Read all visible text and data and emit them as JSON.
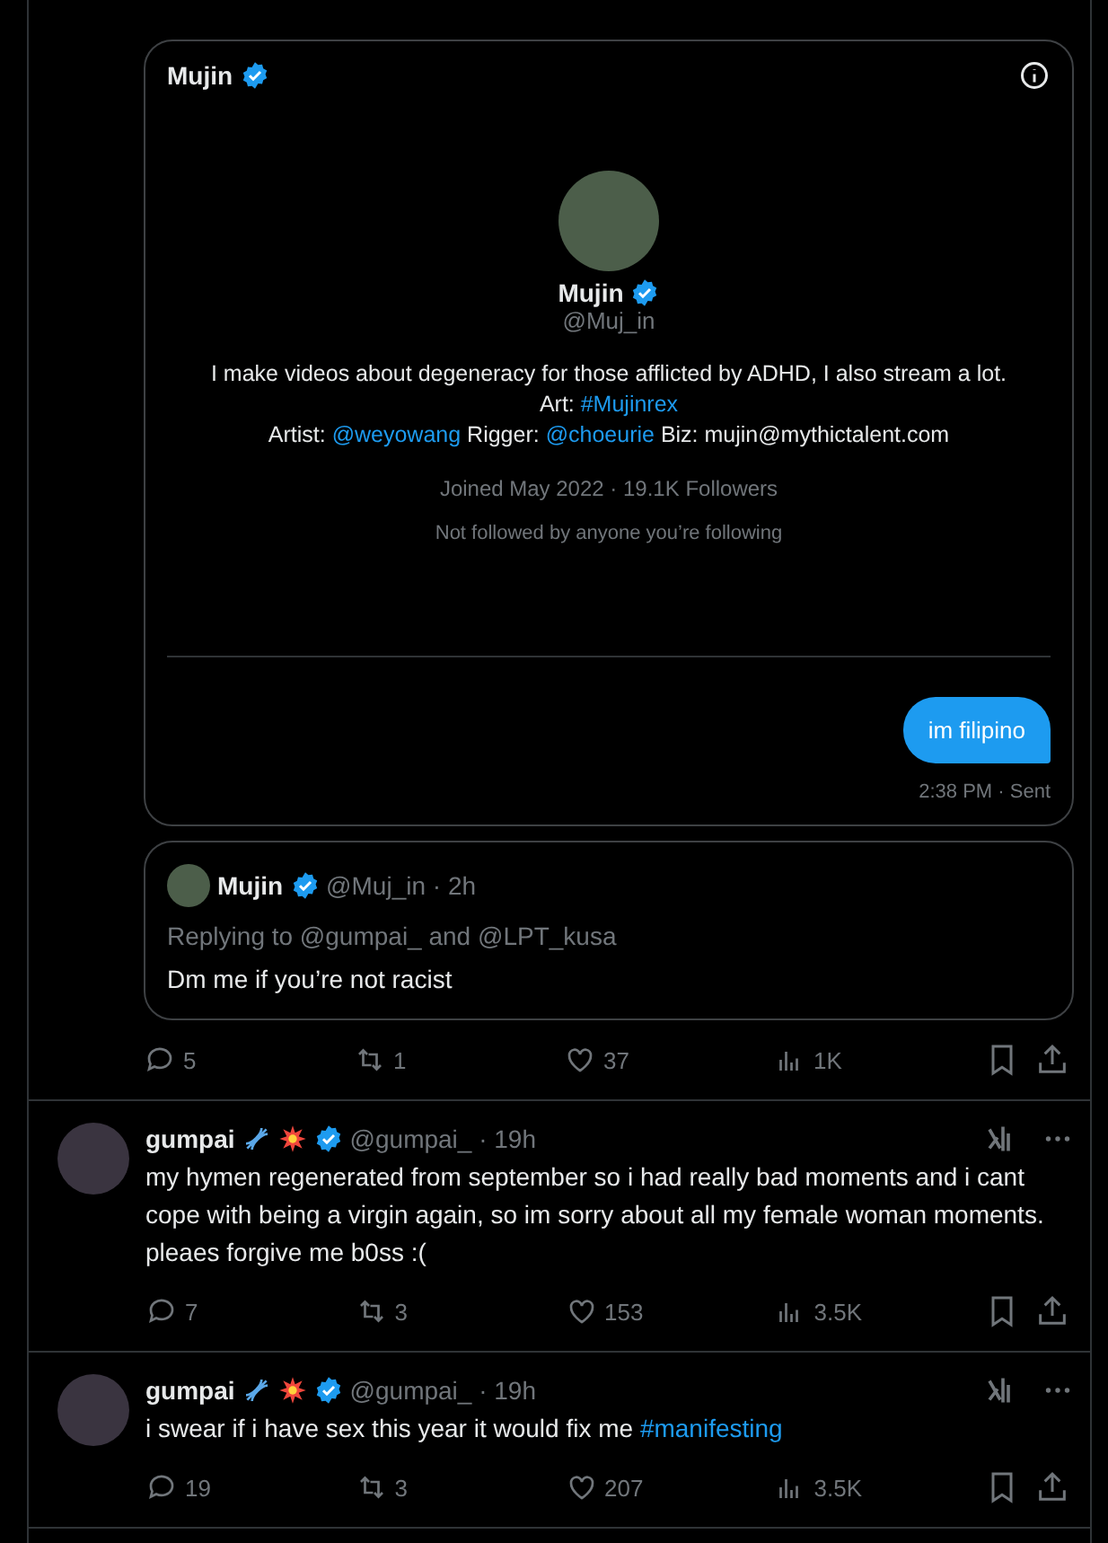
{
  "dm_card": {
    "header_name": "Mujin",
    "verified": true,
    "profile": {
      "name": "Mujin",
      "verified": true,
      "handle": "@Muj_in",
      "bio_lines": [
        [
          {
            "text": "I make videos about degeneracy for those afflicted by ADHD, I also stream a lot. Art: ",
            "link": false
          },
          {
            "text": "#Mujinrex",
            "link": true
          }
        ],
        [
          {
            "text": "Artist: ",
            "link": false
          },
          {
            "text": "@weyowang",
            "link": true
          },
          {
            "text": " Rigger: ",
            "link": false
          },
          {
            "text": "@choeurie",
            "link": true
          },
          {
            "text": " Biz: mujin@mythictalent.com",
            "link": false
          }
        ]
      ],
      "joined": "Joined May 2022 · 19.1K Followers",
      "mutuals": "Not followed by anyone you’re following"
    },
    "message": {
      "text": "im filipino",
      "meta": "2:38 PM · Sent"
    }
  },
  "quoted": {
    "name": "Mujin",
    "verified": true,
    "handle": "@Muj_in · 2h",
    "replying": "Replying to @gumpai_ and @LPT_kusa",
    "text": "Dm me if you’re not racist"
  },
  "main_actions": {
    "replies": "5",
    "reposts": "1",
    "likes": "37",
    "views": "1K"
  },
  "tweets": [
    {
      "name": "gumpai",
      "verified": true,
      "handle": "@gumpai_ · 19h",
      "body": [
        {
          "text": "my hymen regenerated from september so i had really bad moments and i cant cope with being a virgin again, so im sorry about all my female woman moments. pleaes forgive me b0ss :(",
          "link": false
        }
      ],
      "replies": "7",
      "reposts": "3",
      "likes": "153",
      "views": "3.5K"
    },
    {
      "name": "gumpai",
      "verified": true,
      "handle": "@gumpai_ · 19h",
      "body": [
        {
          "text": "i swear if i have sex this year it would fix me ",
          "link": false
        },
        {
          "text": "#manifesting",
          "link": true
        }
      ],
      "replies": "19",
      "reposts": "3",
      "likes": "207",
      "views": "3.5K"
    }
  ]
}
